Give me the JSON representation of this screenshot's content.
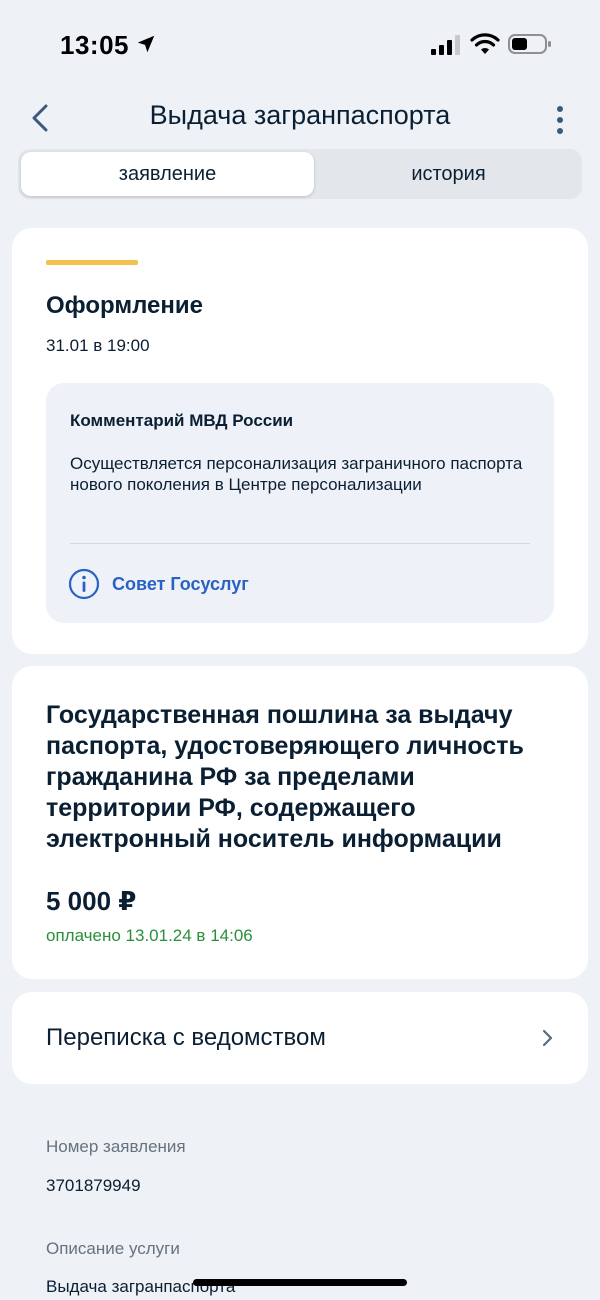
{
  "status_bar": {
    "time": "13:05",
    "icons": [
      "location-arrow-icon",
      "signal-icon",
      "wifi-icon",
      "battery-icon"
    ]
  },
  "nav": {
    "title": "Выдача загранпаспорта",
    "icons": [
      "back-chevron-icon",
      "more-vertical-icon"
    ]
  },
  "tabs": [
    {
      "label": "заявление",
      "active": true
    },
    {
      "label": "история",
      "active": false
    }
  ],
  "status_card": {
    "stripe_color": "#f2c14e",
    "title": "Оформление",
    "date": "31.01 в 19:00",
    "comment": {
      "title": "Комментарий МВД России",
      "text": "Осуществляется персонализация заграничного паспорта нового поколения в Центре персонализации",
      "advice_label": "Совет Госуслуг",
      "advice_icon": "info-circle-icon"
    }
  },
  "fee_card": {
    "title": "Государственная пошлина за выдачу паспорта, удостоверяющего личность гражданина РФ за пределами территории РФ, содержащего электронный носитель информации",
    "amount": "5 000 ₽",
    "paid_text": "оплачено 13.01.24 в 14:06",
    "paid_color": "#2a8f3a"
  },
  "correspondence": {
    "label": "Переписка с ведомством",
    "icon": "chevron-right-icon"
  },
  "info": {
    "application_number_label": "Номер заявления",
    "application_number": "3701879949",
    "service_description_label": "Описание услуги",
    "service_description": "Выдача загранпаспорта"
  },
  "colors": {
    "accent_blue": "#2962c4",
    "background": "#eef1f5",
    "text": "#0b1f33"
  }
}
